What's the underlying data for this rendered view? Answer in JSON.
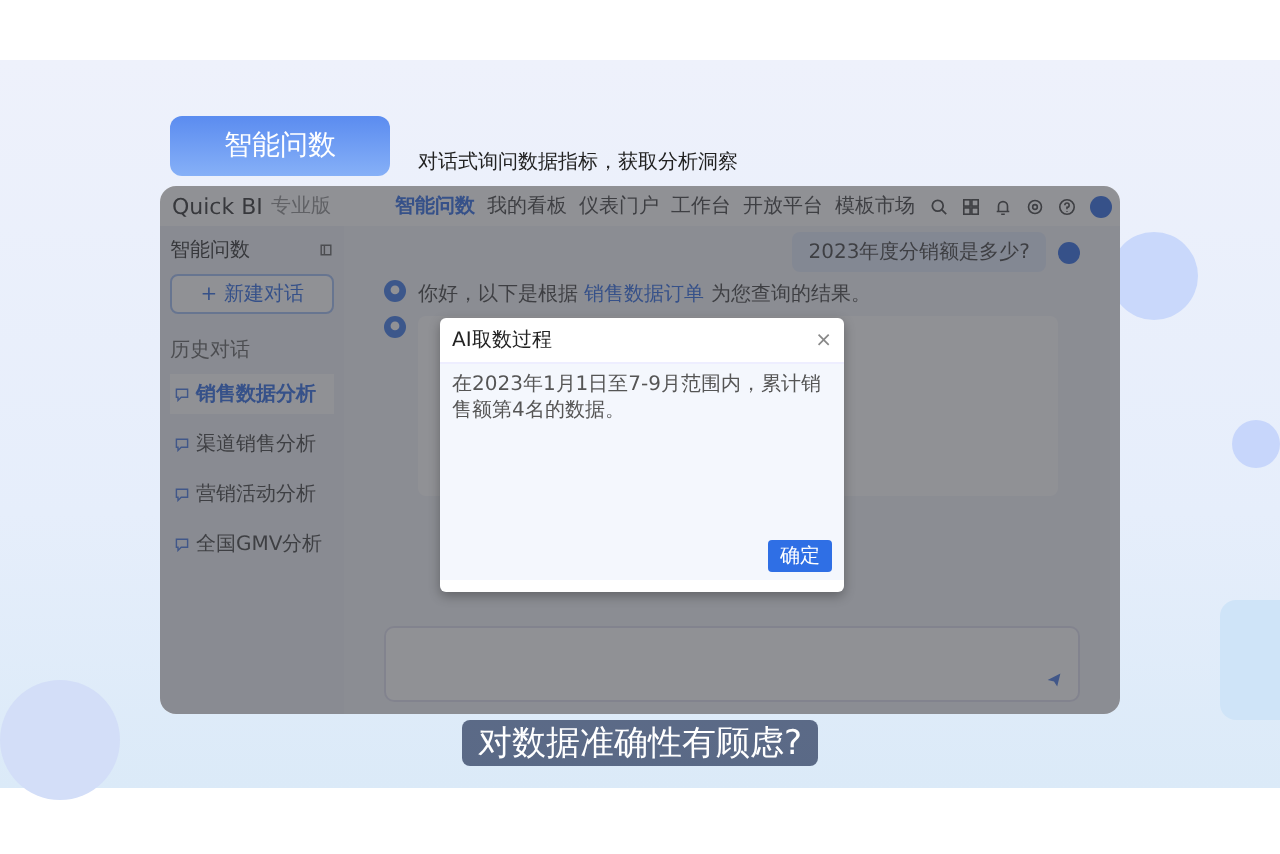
{
  "banner": {
    "title": "智能问数",
    "caption": "对话式询问数据指标，获取分析洞察"
  },
  "app": {
    "logo": "Quick BI",
    "edition": "专业版",
    "nav": [
      {
        "label": "智能问数",
        "selected": true
      },
      {
        "label": "我的看板",
        "selected": false
      },
      {
        "label": "仪表门户",
        "selected": false
      },
      {
        "label": "工作台",
        "selected": false
      },
      {
        "label": "开放平台",
        "selected": false
      },
      {
        "label": "模板市场",
        "selected": false
      }
    ],
    "sidebar": {
      "title": "智能问数",
      "new_button": "+ 新建对话",
      "section": "历史对话",
      "items": [
        {
          "label": "销售数据分析",
          "selected": true
        },
        {
          "label": "渠道销售分析",
          "selected": false
        },
        {
          "label": "营销活动分析",
          "selected": false
        },
        {
          "label": "全国GMV分析",
          "selected": false
        }
      ]
    },
    "chat": {
      "user_question": "2023年度分销额是多少?",
      "bot_message": {
        "before": "你好，以下是根据",
        "link": "销售数据订单",
        "after": "为您查询的结果。"
      }
    }
  },
  "dialog": {
    "title": "AI取数过程",
    "close": "×",
    "body": "在2023年1月1日至7-9月范围内，累计销售额第4名的数据。",
    "ok": "确定"
  },
  "subtitle": "对数据准确性有顾虑?"
}
